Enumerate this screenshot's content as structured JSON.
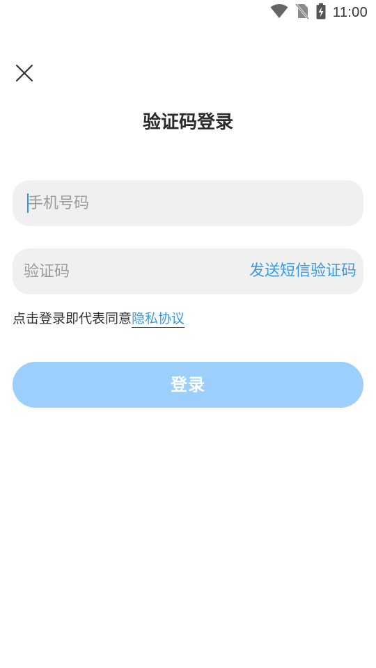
{
  "status_bar": {
    "time": "11:00",
    "icons": [
      "wifi-icon",
      "no-sim-icon",
      "battery-charging-icon"
    ]
  },
  "header": {
    "close_icon": "close-icon",
    "title": "验证码登录"
  },
  "form": {
    "phone": {
      "placeholder": "手机号码",
      "value": ""
    },
    "code": {
      "placeholder": "验证码",
      "value": "",
      "send_label": "发送短信验证码"
    },
    "agreement": {
      "prefix": "点击登录即代表同意",
      "link_label": "隐私协议"
    },
    "login_label": "登录"
  },
  "colors": {
    "accent": "#3b9ae8",
    "login_button_disabled": "#9ccffb",
    "field_background": "#f0f0f0",
    "caret": "#2f8fff"
  }
}
